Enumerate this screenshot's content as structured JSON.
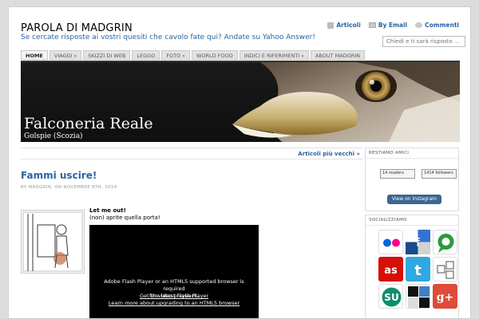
{
  "site": {
    "title": "PAROLA DI MADGRIN",
    "description": "Se cercate risposte ai vostri quesiti che cavolo fate qui? Andate su Yahoo Answer!"
  },
  "toplinks": {
    "articles": "Articoli",
    "by_email": "By Email",
    "comments": "Commenti"
  },
  "search": {
    "placeholder": "Chiedi e ti sarà risposto ..."
  },
  "nav": {
    "home": "HOME",
    "viaggi": "VIAGGI",
    "skizzi": "SKIZZI DI WEB",
    "leggo": "LEGGO",
    "foto": "FOTO",
    "world_food": "WORLD FOOD",
    "link": "INDICI E RIFERIMENTI",
    "about": "ABOUT MADGRIN"
  },
  "header": {
    "title": "Falconeria Reale",
    "subtitle": "Golspie (Scozia)"
  },
  "older_link": "Articoli più vecchi »",
  "post": {
    "title": "Fammi uscire!",
    "meta": "BY MADGRIN, ON NOVEMBRE 8TH, 2014",
    "line1": "Let me out!",
    "line2": "(non) aprite quella porta!"
  },
  "flash": {
    "line1": "Adobe Flash Player or an HTML5 supported browser is required",
    "line2": "for video playback.",
    "link1": "Get the latest Flash Player",
    "link2": "Learn more about upgrading to an HTML5 browser"
  },
  "sidebar": {
    "friends_title": "RESTIAMO AMICI",
    "badge1_num": "14",
    "badge1_text": "readers",
    "badge2_num": "1414",
    "badge2_text": "followers",
    "instagram": "View on Instagram",
    "social_title": "SOCIALIZZIAMO",
    "social_icons": [
      "flickr-icon",
      "delicious-icon",
      "technorati-icon",
      "lastfm-icon",
      "twitter-icon",
      "diigo-icon",
      "stumbleupon-icon",
      "digg-icon",
      "google-plus-icon"
    ]
  },
  "colors": {
    "link": "#2a64a0",
    "flickr": "#ffffff",
    "lastfm": "#d51007",
    "twitter": "#2fa9e1",
    "google": "#dd4b39",
    "stumble": "#0f8d6c",
    "technorati": "#2b9a3c"
  }
}
